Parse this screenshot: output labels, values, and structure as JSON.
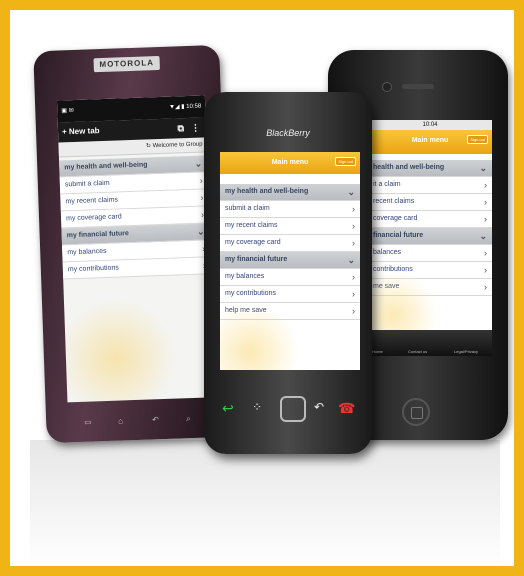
{
  "accent_color": "#f0b416",
  "motorola": {
    "brand": "MOTOROLA",
    "status_left": "▣ ✉",
    "status_right": "▼◢ ▮ 10:58",
    "tab_label": "+ New tab",
    "url_text": "Welcome to Group",
    "rows": [
      {
        "label": "my health and well-being",
        "section": true
      },
      {
        "label": "submit a claim",
        "section": false
      },
      {
        "label": "my recent claims",
        "section": false
      },
      {
        "label": "my coverage card",
        "section": false
      },
      {
        "label": "my financial future",
        "section": true
      },
      {
        "label": "my balances",
        "section": false
      },
      {
        "label": "my contributions",
        "section": false
      }
    ]
  },
  "blackberry": {
    "logo": "BlackBerry",
    "menu_title": "Main menu",
    "sign_out": "Sign out",
    "rows": [
      {
        "label": "my health and well-being",
        "section": true
      },
      {
        "label": "submit a claim",
        "section": false
      },
      {
        "label": "my recent claims",
        "section": false
      },
      {
        "label": "my coverage card",
        "section": false
      },
      {
        "label": "my financial future",
        "section": true
      },
      {
        "label": "my balances",
        "section": false
      },
      {
        "label": "my contributions",
        "section": false
      },
      {
        "label": "help me save",
        "section": false
      }
    ]
  },
  "iphone": {
    "status_time": "10:04",
    "menu_title": "Main menu",
    "sign_out": "Sign out",
    "rows": [
      {
        "label": "health and well-being",
        "section": true
      },
      {
        "label": "it a claim",
        "section": false
      },
      {
        "label": "recent claims",
        "section": false
      },
      {
        "label": "coverage card",
        "section": false
      },
      {
        "label": "financial future",
        "section": true
      },
      {
        "label": "balances",
        "section": false
      },
      {
        "label": "contributions",
        "section": false
      },
      {
        "label": "me save",
        "section": false
      }
    ],
    "tabs": [
      "Home",
      "Contact us",
      "Legal/Privacy"
    ]
  }
}
